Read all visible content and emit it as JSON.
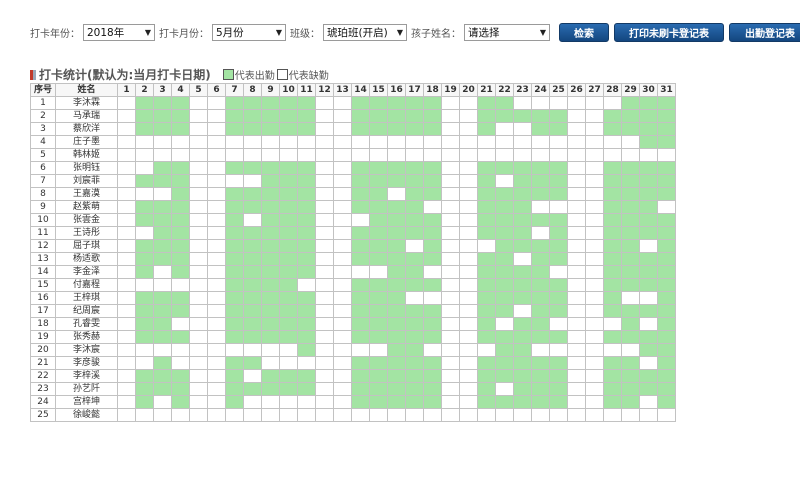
{
  "filters": {
    "year_label": "打卡年份：",
    "year_value": "2018年",
    "month_label": "打卡月份：",
    "month_value": "5月份",
    "class_label": "班级：",
    "class_value": "琥珀班(开启)",
    "child_label": "孩子姓名：",
    "child_value": "请选择"
  },
  "buttons": {
    "search": "检索",
    "print_unswiped": "打印未刷卡登记表",
    "print_attendance": "出勤登记表"
  },
  "section": {
    "title": "打卡统计(默认为:当月打卡日期)",
    "legend_present": "代表出勤",
    "legend_absent": "代表缺勤"
  },
  "colors": {
    "present": "#a3e4a3",
    "absent": "#ffffff",
    "button": "#1d5694"
  },
  "table": {
    "header_index": "序号",
    "header_name": "姓名",
    "days": [
      "1",
      "2",
      "3",
      "4",
      "5",
      "6",
      "7",
      "8",
      "9",
      "10",
      "11",
      "12",
      "13",
      "14",
      "15",
      "16",
      "17",
      "18",
      "19",
      "20",
      "21",
      "22",
      "23",
      "24",
      "25",
      "26",
      "27",
      "28",
      "29",
      "30",
      "31"
    ],
    "rows": [
      {
        "index": "1",
        "name": "李沐霖",
        "present": [
          2,
          3,
          4,
          7,
          8,
          9,
          10,
          11,
          14,
          15,
          16,
          17,
          18,
          21,
          22,
          29,
          30,
          31
        ]
      },
      {
        "index": "2",
        "name": "马承瑞",
        "present": [
          2,
          3,
          4,
          7,
          8,
          9,
          10,
          11,
          14,
          15,
          16,
          17,
          18,
          21,
          22,
          23,
          24,
          25,
          28,
          29,
          30,
          31
        ]
      },
      {
        "index": "3",
        "name": "蔡欣洋",
        "present": [
          2,
          3,
          4,
          7,
          8,
          9,
          10,
          11,
          14,
          15,
          16,
          17,
          18,
          21,
          24,
          25,
          28,
          29,
          30,
          31
        ]
      },
      {
        "index": "4",
        "name": "庄子墨",
        "present": [
          30,
          31
        ]
      },
      {
        "index": "5",
        "name": "韩林姬",
        "present": []
      },
      {
        "index": "6",
        "name": "张明钰",
        "present": [
          3,
          4,
          7,
          8,
          9,
          10,
          11,
          14,
          15,
          16,
          17,
          18,
          21,
          22,
          23,
          24,
          25,
          28,
          29,
          30,
          31
        ]
      },
      {
        "index": "7",
        "name": "刘宸菲",
        "present": [
          2,
          3,
          4,
          9,
          10,
          11,
          14,
          15,
          16,
          17,
          18,
          21,
          23,
          24,
          25,
          28,
          29,
          30,
          31
        ]
      },
      {
        "index": "8",
        "name": "王嘉漠",
        "present": [
          4,
          7,
          8,
          9,
          10,
          11,
          14,
          15,
          17,
          18,
          21,
          22,
          23,
          24,
          25,
          28,
          29,
          30,
          31
        ]
      },
      {
        "index": "9",
        "name": "赵紫萌",
        "present": [
          2,
          3,
          4,
          7,
          8,
          9,
          10,
          11,
          14,
          15,
          16,
          17,
          21,
          22,
          23,
          28,
          29,
          30
        ]
      },
      {
        "index": "10",
        "name": "张雲金",
        "present": [
          2,
          3,
          4,
          7,
          9,
          10,
          11,
          15,
          16,
          17,
          18,
          21,
          22,
          23,
          24,
          25,
          28,
          29,
          30,
          31
        ]
      },
      {
        "index": "11",
        "name": "王诗彤",
        "present": [
          3,
          4,
          7,
          8,
          9,
          10,
          11,
          14,
          15,
          16,
          17,
          18,
          21,
          22,
          23,
          25,
          28,
          29,
          30,
          31
        ]
      },
      {
        "index": "12",
        "name": "屈子琪",
        "present": [
          2,
          3,
          4,
          7,
          8,
          9,
          10,
          11,
          14,
          15,
          16,
          18,
          22,
          23,
          24,
          25,
          28,
          29,
          31
        ]
      },
      {
        "index": "13",
        "name": "杨适歌",
        "present": [
          2,
          3,
          4,
          7,
          8,
          9,
          10,
          11,
          14,
          15,
          16,
          17,
          18,
          21,
          22,
          24,
          25,
          28,
          29,
          30,
          31
        ]
      },
      {
        "index": "14",
        "name": "李金泽",
        "present": [
          2,
          4,
          7,
          8,
          9,
          10,
          11,
          16,
          17,
          21,
          22,
          23,
          24,
          28,
          29,
          30,
          31
        ]
      },
      {
        "index": "15",
        "name": "付嘉程",
        "present": [
          7,
          8,
          9,
          10,
          14,
          15,
          16,
          17,
          18,
          21,
          22,
          23,
          24,
          25,
          28,
          29,
          30,
          31
        ]
      },
      {
        "index": "16",
        "name": "王梓琪",
        "present": [
          2,
          3,
          4,
          7,
          8,
          9,
          10,
          11,
          14,
          15,
          16,
          21,
          22,
          23,
          24,
          25,
          28,
          31
        ]
      },
      {
        "index": "17",
        "name": "纪周宸",
        "present": [
          2,
          3,
          4,
          7,
          8,
          9,
          10,
          11,
          14,
          15,
          16,
          17,
          18,
          21,
          22,
          24,
          25,
          28,
          29,
          30,
          31
        ]
      },
      {
        "index": "18",
        "name": "孔睿雯",
        "present": [
          2,
          3,
          7,
          8,
          9,
          10,
          11,
          14,
          15,
          16,
          17,
          18,
          21,
          23,
          24,
          29,
          31
        ]
      },
      {
        "index": "19",
        "name": "张秀赫",
        "present": [
          2,
          3,
          4,
          7,
          8,
          9,
          10,
          11,
          14,
          15,
          16,
          17,
          18,
          21,
          22,
          23,
          24,
          25,
          28,
          29,
          30,
          31
        ]
      },
      {
        "index": "20",
        "name": "李沐宸",
        "present": [
          11,
          16,
          17,
          22,
          23,
          30,
          31
        ]
      },
      {
        "index": "21",
        "name": "李彦骏",
        "present": [
          3,
          7,
          8,
          14,
          15,
          16,
          17,
          18,
          21,
          22,
          23,
          24,
          25,
          28,
          29,
          31
        ]
      },
      {
        "index": "22",
        "name": "李梓溪",
        "present": [
          2,
          3,
          4,
          7,
          9,
          10,
          11,
          14,
          15,
          16,
          17,
          18,
          21,
          22,
          23,
          24,
          25,
          28,
          29,
          30,
          31
        ]
      },
      {
        "index": "23",
        "name": "孙艺阡",
        "present": [
          2,
          3,
          4,
          7,
          8,
          9,
          10,
          11,
          14,
          15,
          16,
          17,
          18,
          21,
          23,
          24,
          25,
          28,
          29,
          30,
          31
        ]
      },
      {
        "index": "24",
        "name": "宫梓坤",
        "present": [
          2,
          4,
          7,
          14,
          15,
          16,
          17,
          18,
          21,
          22,
          23,
          24,
          25,
          28,
          29,
          31
        ]
      },
      {
        "index": "25",
        "name": "徐峻懿",
        "present": []
      }
    ]
  }
}
